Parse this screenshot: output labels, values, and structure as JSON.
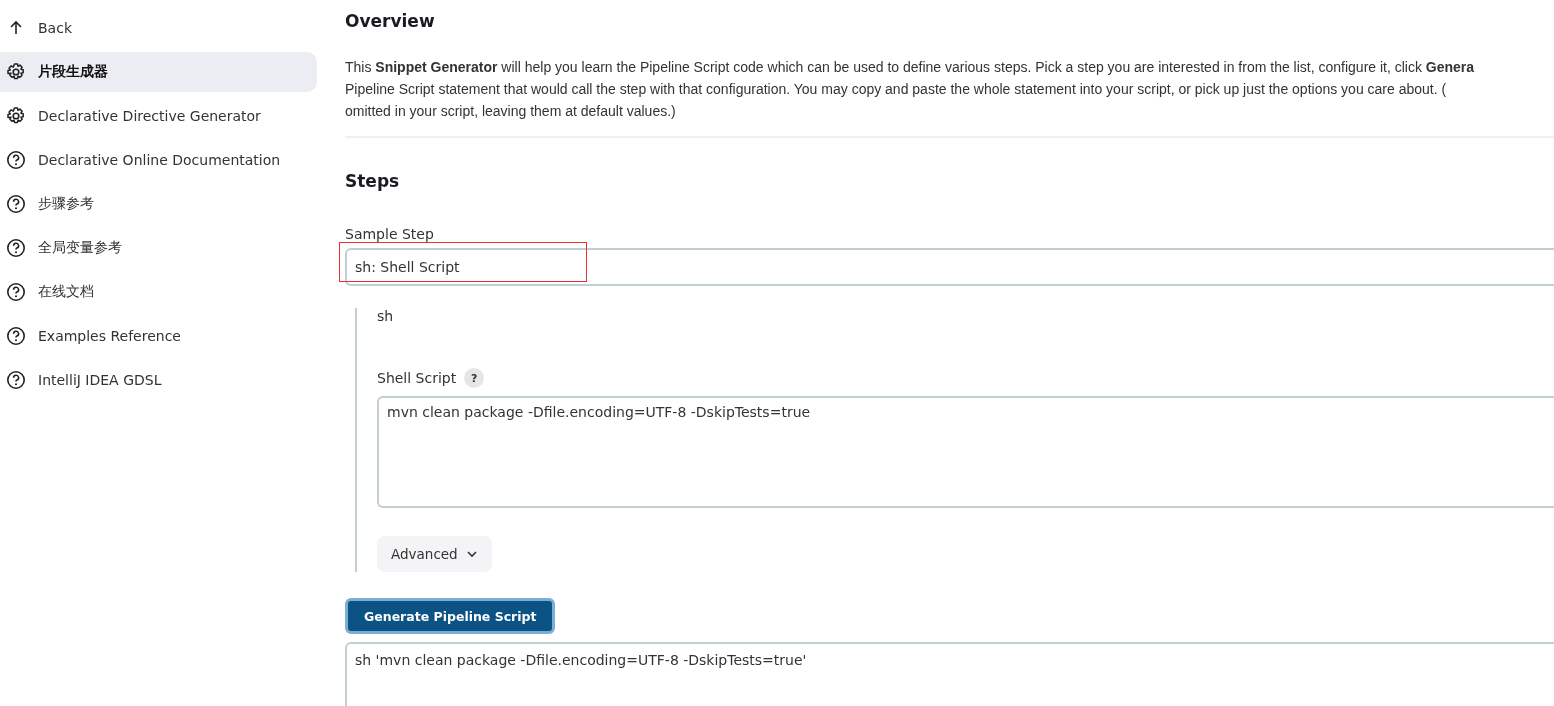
{
  "sidebar": {
    "items": [
      {
        "label": "Back",
        "kind": "back",
        "selected": false
      },
      {
        "label": "片段生成器",
        "kind": "generator",
        "selected": true
      },
      {
        "label": "Declarative Directive Generator",
        "kind": "generator",
        "selected": false
      },
      {
        "label": "Declarative Online Documentation",
        "kind": "doc",
        "selected": false
      },
      {
        "label": "步骤参考",
        "kind": "doc",
        "selected": false
      },
      {
        "label": "全局变量参考",
        "kind": "doc",
        "selected": false
      },
      {
        "label": "在线文档",
        "kind": "doc",
        "selected": false
      },
      {
        "label": "Examples Reference",
        "kind": "doc",
        "selected": false
      },
      {
        "label": "IntelliJ IDEA GDSL",
        "kind": "doc",
        "selected": false
      }
    ]
  },
  "overview": {
    "title": "Overview",
    "lines": [
      "This **Snippet Generator** will help you learn the Pipeline Script code which can be used to define various steps. Pick a step you are interested in from the list, configure it, click **Genera**",
      "Pipeline Script statement that would call the step with that configuration. You may copy and paste the whole statement into your script, or pick up just the options you care about. (",
      "omitted in your script, leaving them at default values.)"
    ]
  },
  "steps": {
    "title": "Steps",
    "sample_step": {
      "label": "Sample Step",
      "value": "sh: Shell Script",
      "highlighted": true
    },
    "step_name": "sh",
    "shell_script": {
      "label": "Shell Script",
      "help": "?",
      "value": "mvn clean package -Dfile.encoding=UTF-8 -DskipTests=true"
    },
    "advanced_button": "Advanced",
    "generate_button": "Generate Pipeline Script",
    "output": "sh 'mvn clean package -Dfile.encoding=UTF-8 -DskipTests=true'"
  }
}
